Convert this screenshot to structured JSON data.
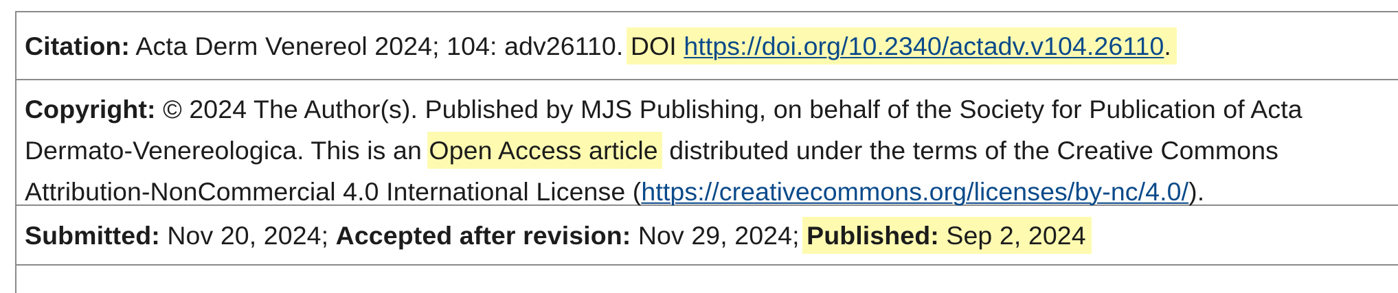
{
  "citation": {
    "label": "Citation:",
    "text": " Acta Derm Venereol 2024; 104: adv26110. ",
    "doi_prefix": "DOI ",
    "doi_link": "https://doi.org/10.2340/actadv.v104.26110",
    "doi_suffix": "."
  },
  "copyright": {
    "label": "Copyright:",
    "text_1": " © 2024 The Author(s). Published by MJS Publishing, on behalf of the Society for Publication of Acta Dermato-Venereologica. This is an ",
    "highlight": "Open Access article",
    "text_2": " distributed under the terms of the Creative Commons Attribution-NonCommercial 4.0 International License (",
    "license_link": "https://creativecommons.org/licenses/by-nc/4.0/",
    "text_3": ")."
  },
  "dates": {
    "submitted_label": "Submitted:",
    "submitted_value": " Nov 20, 2024; ",
    "accepted_label": "Accepted after revision:",
    "accepted_value": " Nov 29, 2024; ",
    "published_label": "Published:",
    "published_value": " Sep 2, 2024"
  },
  "colors": {
    "highlight": "#fefbb1",
    "link": "#0a4a8a",
    "border": "#8a8a8a"
  }
}
